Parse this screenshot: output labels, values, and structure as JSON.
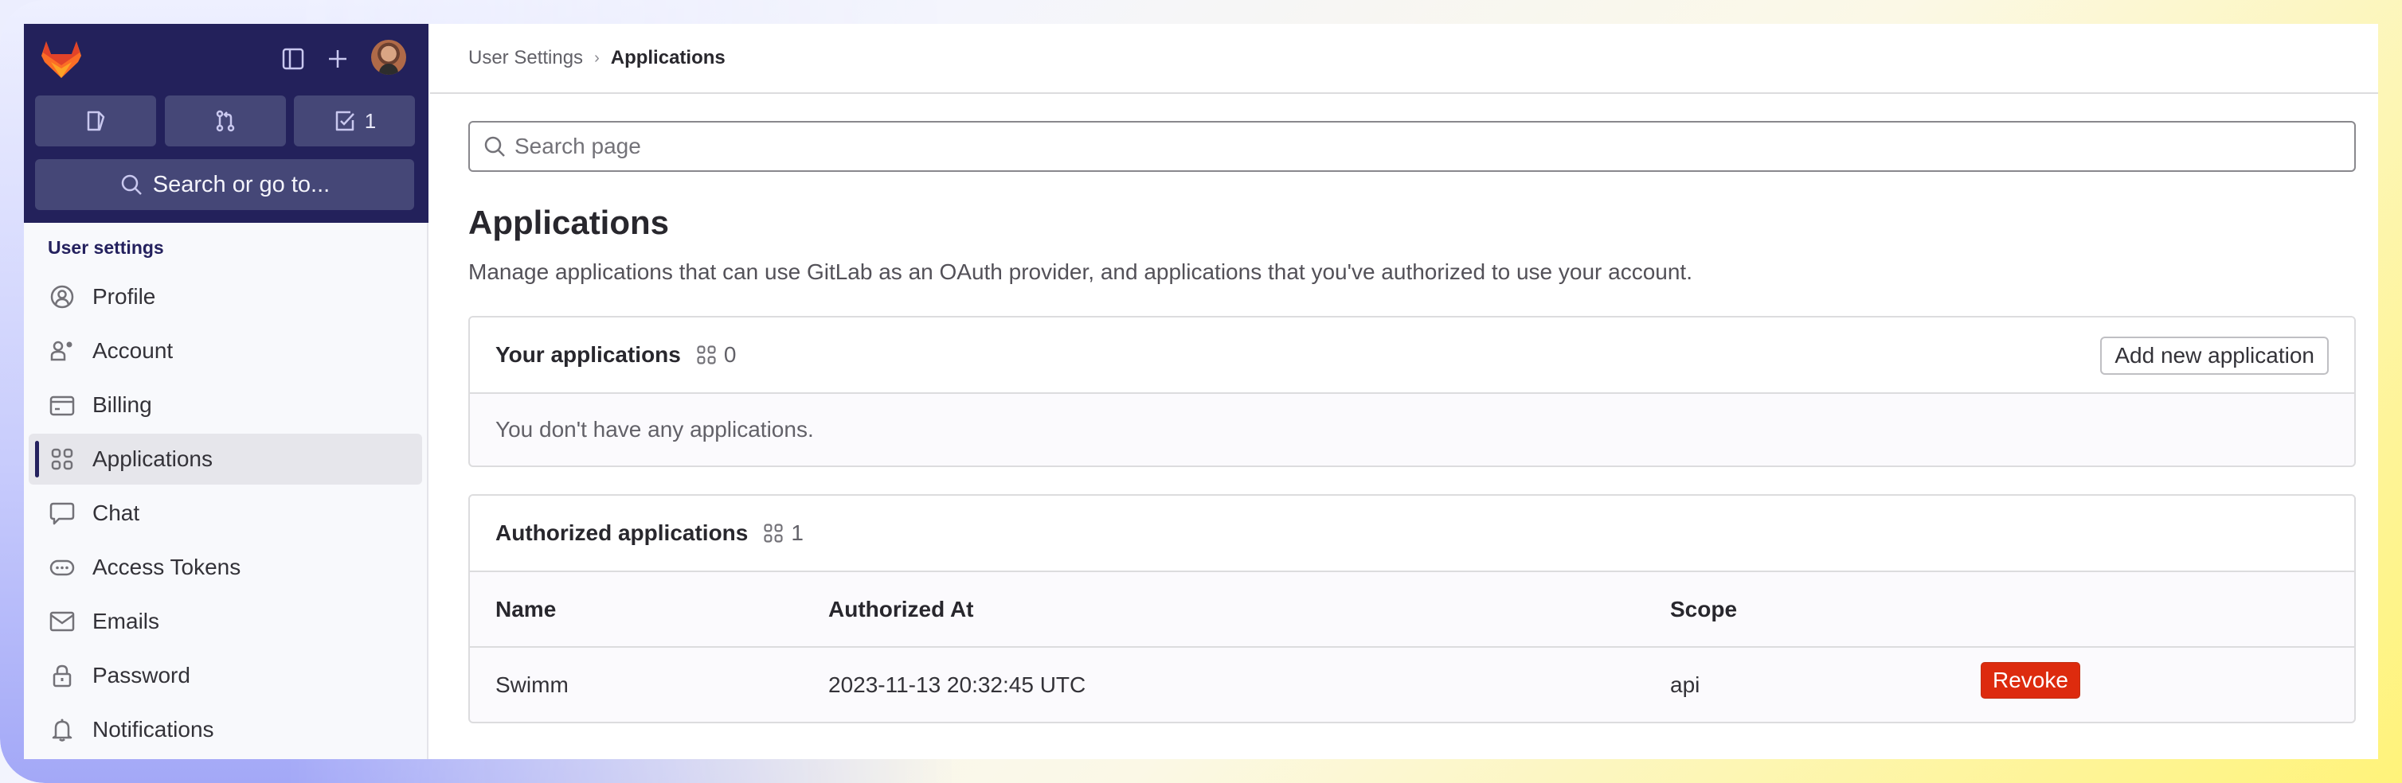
{
  "sidebar": {
    "quick_actions": [
      {
        "icon": "issues-icon",
        "label": ""
      },
      {
        "icon": "merge-request-icon",
        "label": ""
      },
      {
        "icon": "todo-icon",
        "label": "1"
      }
    ],
    "search_label": "Search or go to...",
    "section_title": "User settings",
    "items": [
      {
        "label": "Profile",
        "icon": "profile-icon",
        "active": false
      },
      {
        "label": "Account",
        "icon": "account-icon",
        "active": false
      },
      {
        "label": "Billing",
        "icon": "billing-icon",
        "active": false
      },
      {
        "label": "Applications",
        "icon": "applications-icon",
        "active": true
      },
      {
        "label": "Chat",
        "icon": "chat-icon",
        "active": false
      },
      {
        "label": "Access Tokens",
        "icon": "token-icon",
        "active": false
      },
      {
        "label": "Emails",
        "icon": "mail-icon",
        "active": false
      },
      {
        "label": "Password",
        "icon": "lock-icon",
        "active": false
      },
      {
        "label": "Notifications",
        "icon": "bell-icon",
        "active": false
      }
    ]
  },
  "breadcrumb": {
    "parent": "User Settings",
    "separator": "›",
    "current": "Applications"
  },
  "search": {
    "placeholder": "Search page",
    "value": ""
  },
  "page": {
    "title": "Applications",
    "description": "Manage applications that can use GitLab as an OAuth provider, and applications that you've authorized to use your account."
  },
  "your_applications": {
    "title": "Your applications",
    "count": "0",
    "add_button": "Add new application",
    "empty_message": "You don't have any applications."
  },
  "authorized_applications": {
    "title": "Authorized applications",
    "count": "1",
    "columns": [
      "Name",
      "Authorized At",
      "Scope",
      ""
    ],
    "rows": [
      {
        "name": "Swimm",
        "authorized_at": "2023-11-13 20:32:45 UTC",
        "scope": "api",
        "action": "Revoke"
      }
    ]
  },
  "colors": {
    "sidebar_header": "#23215b",
    "danger": "#dd2b0e",
    "active_indicator": "#24215e"
  }
}
